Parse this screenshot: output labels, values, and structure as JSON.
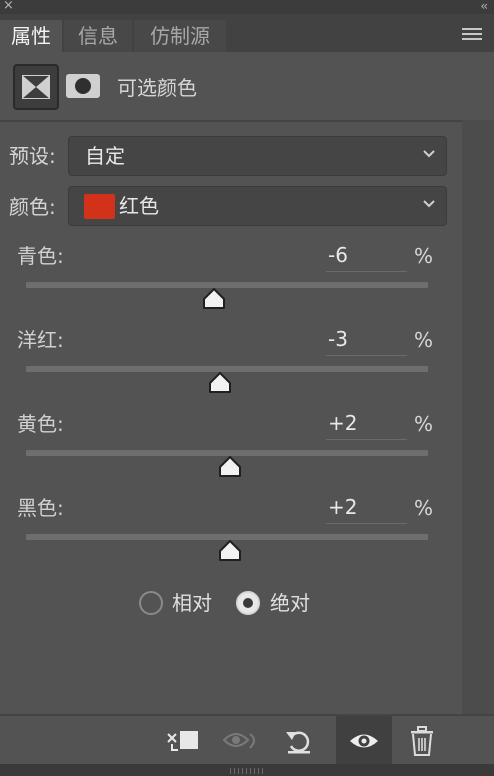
{
  "window": {
    "close_glyph": "×",
    "collapse_glyph": "‹‹"
  },
  "tabs": [
    {
      "label": "属性",
      "active": true
    },
    {
      "label": "信息",
      "active": false
    },
    {
      "label": "仿制源",
      "active": false
    }
  ],
  "header": {
    "title": "可选颜色"
  },
  "preset": {
    "label": "预设:",
    "value": "自定"
  },
  "colors": {
    "label": "颜色:",
    "value": "红色",
    "swatch": "#d23219"
  },
  "sliders": [
    {
      "label": "青色:",
      "value": "-6",
      "unit": "%",
      "position": 0.47
    },
    {
      "label": "洋红:",
      "value": "-3",
      "unit": "%",
      "position": 0.483
    },
    {
      "label": "黄色:",
      "value": "+2",
      "unit": "%",
      "position": 0.505
    },
    {
      "label": "黑色:",
      "value": "+2",
      "unit": "%",
      "position": 0.505
    }
  ],
  "method": {
    "options": [
      {
        "label": "相对",
        "checked": false
      },
      {
        "label": "绝对",
        "checked": true
      }
    ]
  },
  "toolbar": {
    "icons": [
      "clip-to-layer-icon",
      "view-previous-state-icon",
      "reset-icon",
      "visibility-icon",
      "trash-icon"
    ]
  },
  "colors_theme": {
    "panel_bg": "#535353",
    "tab_bar": "#424242",
    "accent_swatch": "#d23219"
  }
}
